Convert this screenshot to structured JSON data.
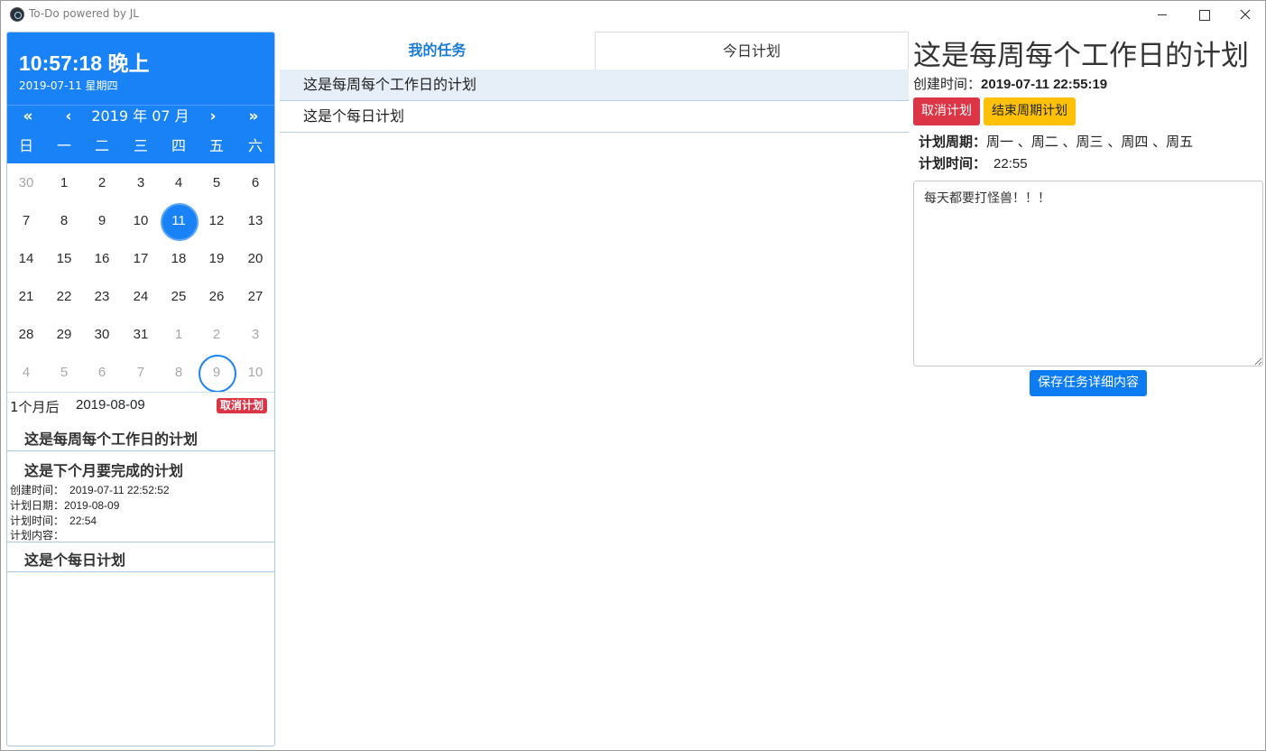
{
  "window": {
    "title": "To-Do powered by JL"
  },
  "calendar": {
    "clock": "10:57:18 晚上",
    "date_line": "2019-07-11 星期四",
    "nav": {
      "prev_year": "«",
      "prev_month": "‹",
      "next_month": "›",
      "next_year": "»"
    },
    "month_label": "2019 年 07 月",
    "weekdays": [
      "日",
      "一",
      "二",
      "三",
      "四",
      "五",
      "六"
    ],
    "weeks": [
      [
        "30",
        "1",
        "2",
        "3",
        "4",
        "5",
        "6"
      ],
      [
        "7",
        "8",
        "9",
        "10",
        "11",
        "12",
        "13"
      ],
      [
        "14",
        "15",
        "16",
        "17",
        "18",
        "19",
        "20"
      ],
      [
        "21",
        "22",
        "23",
        "24",
        "25",
        "26",
        "27"
      ],
      [
        "28",
        "29",
        "30",
        "31",
        "1",
        "2",
        "3"
      ],
      [
        "4",
        "5",
        "6",
        "7",
        "8",
        "9",
        "10"
      ]
    ]
  },
  "selection": {
    "relative": "1个月后",
    "date": "2019-08-09",
    "cancel_label": "取消计划"
  },
  "plans": [
    {
      "title": "这是每周每个工作日的计划"
    },
    {
      "title": "这是下个月要完成的计划",
      "created_label": "创建时间：",
      "created": "2019-07-11 22:52:52",
      "date_label": "计划日期：",
      "date": "2019-08-09",
      "time_label": "计划时间：",
      "time": "22:54",
      "content_label": "计划内容："
    },
    {
      "title": "这是个每日计划"
    }
  ],
  "tabs": {
    "mine": "我的任务",
    "today": "今日计划"
  },
  "tasks": [
    "这是每周每个工作日的计划",
    "这是个每日计划"
  ],
  "detail": {
    "title": "这是每周每个工作日的计划",
    "created_label": "创建时间：",
    "created": "2019-07-11 22:55:19",
    "cancel_button": "取消计划",
    "end_button": "结束周期计划",
    "period_label": "计划周期：",
    "period": "周一 、周二 、周三 、周四 、周五",
    "time_label": "计划时间：",
    "time": "22:55",
    "notes": "每天都要打怪兽！！！",
    "save_button": "保存任务详细内容"
  },
  "colors": {
    "accent": "#1a82f7",
    "danger": "#dc3545",
    "warning": "#ffc107",
    "primary": "#0d7cf2"
  }
}
